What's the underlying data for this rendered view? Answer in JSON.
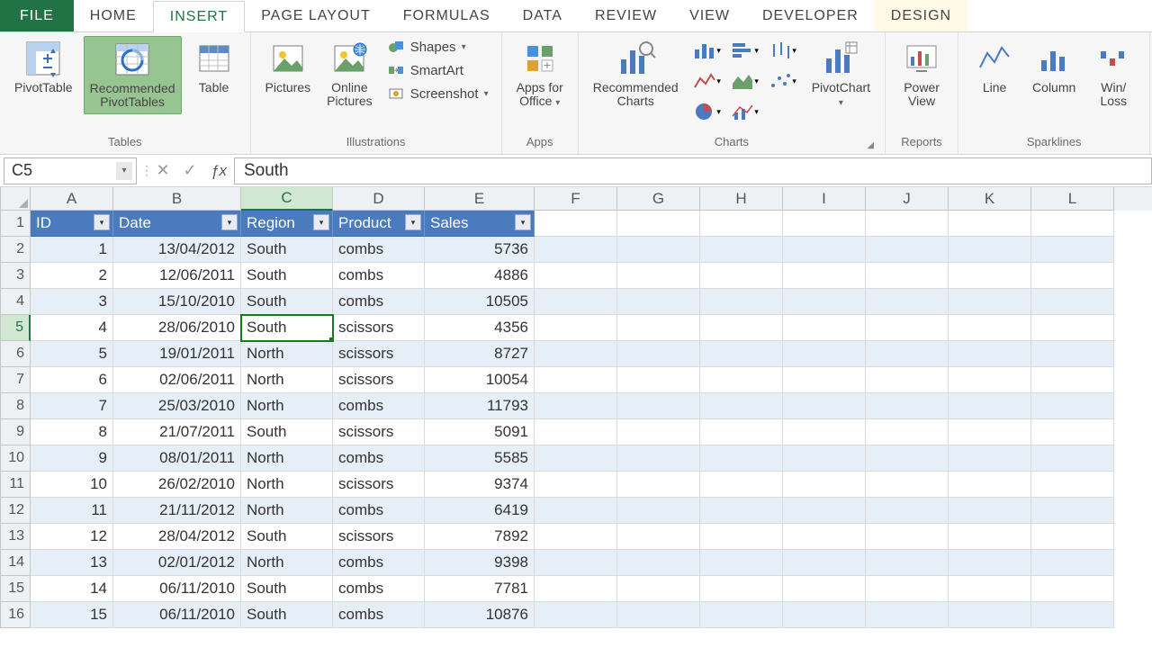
{
  "tabs": {
    "file": "FILE",
    "home": "HOME",
    "insert": "INSERT",
    "page_layout": "PAGE LAYOUT",
    "formulas": "FORMULAS",
    "data": "DATA",
    "review": "REVIEW",
    "view": "VIEW",
    "developer": "DEVELOPER",
    "design": "DESIGN"
  },
  "ribbon": {
    "tables": {
      "pivot_table": "PivotTable",
      "rec_pivot1": "Recommended",
      "rec_pivot2": "PivotTables",
      "table": "Table",
      "group": "Tables"
    },
    "illus": {
      "pictures": "Pictures",
      "online1": "Online",
      "online2": "Pictures",
      "shapes": "Shapes",
      "smartart": "SmartArt",
      "screenshot": "Screenshot",
      "group": "Illustrations"
    },
    "apps": {
      "apps1": "Apps for",
      "apps2": "Office",
      "group": "Apps"
    },
    "charts": {
      "rec1": "Recommended",
      "rec2": "Charts",
      "pivotchart": "PivotChart",
      "group": "Charts"
    },
    "reports": {
      "power1": "Power",
      "power2": "View",
      "group": "Reports"
    },
    "spark": {
      "line": "Line",
      "column": "Column",
      "winloss": "Win/\nLoss",
      "group": "Sparklines"
    }
  },
  "fbar": {
    "name": "C5",
    "formula": "South"
  },
  "columns": [
    "A",
    "B",
    "C",
    "D",
    "E",
    "F",
    "G",
    "H",
    "I",
    "J",
    "K",
    "L"
  ],
  "headers": [
    "ID",
    "Date",
    "Region",
    "Product",
    "Sales"
  ],
  "selected": {
    "row": 5,
    "col": "C"
  },
  "rows": [
    {
      "n": 2,
      "id": "1",
      "date": "13/04/2012",
      "region": "South",
      "product": "combs",
      "sales": "5736",
      "band": true
    },
    {
      "n": 3,
      "id": "2",
      "date": "12/06/2011",
      "region": "South",
      "product": "combs",
      "sales": "4886",
      "band": false
    },
    {
      "n": 4,
      "id": "3",
      "date": "15/10/2010",
      "region": "South",
      "product": "combs",
      "sales": "10505",
      "band": true
    },
    {
      "n": 5,
      "id": "4",
      "date": "28/06/2010",
      "region": "South",
      "product": "scissors",
      "sales": "4356",
      "band": false
    },
    {
      "n": 6,
      "id": "5",
      "date": "19/01/2011",
      "region": "North",
      "product": "scissors",
      "sales": "8727",
      "band": true
    },
    {
      "n": 7,
      "id": "6",
      "date": "02/06/2011",
      "region": "North",
      "product": "scissors",
      "sales": "10054",
      "band": false
    },
    {
      "n": 8,
      "id": "7",
      "date": "25/03/2010",
      "region": "North",
      "product": "combs",
      "sales": "11793",
      "band": true
    },
    {
      "n": 9,
      "id": "8",
      "date": "21/07/2011",
      "region": "South",
      "product": "scissors",
      "sales": "5091",
      "band": false
    },
    {
      "n": 10,
      "id": "9",
      "date": "08/01/2011",
      "region": "North",
      "product": "combs",
      "sales": "5585",
      "band": true
    },
    {
      "n": 11,
      "id": "10",
      "date": "26/02/2010",
      "region": "North",
      "product": "scissors",
      "sales": "9374",
      "band": false
    },
    {
      "n": 12,
      "id": "11",
      "date": "21/11/2012",
      "region": "North",
      "product": "combs",
      "sales": "6419",
      "band": true
    },
    {
      "n": 13,
      "id": "12",
      "date": "28/04/2012",
      "region": "South",
      "product": "scissors",
      "sales": "7892",
      "band": false
    },
    {
      "n": 14,
      "id": "13",
      "date": "02/01/2012",
      "region": "North",
      "product": "combs",
      "sales": "9398",
      "band": true
    },
    {
      "n": 15,
      "id": "14",
      "date": "06/11/2010",
      "region": "South",
      "product": "combs",
      "sales": "7781",
      "band": false
    },
    {
      "n": 16,
      "id": "15",
      "date": "06/11/2010",
      "region": "South",
      "product": "combs",
      "sales": "10876",
      "band": true
    }
  ]
}
